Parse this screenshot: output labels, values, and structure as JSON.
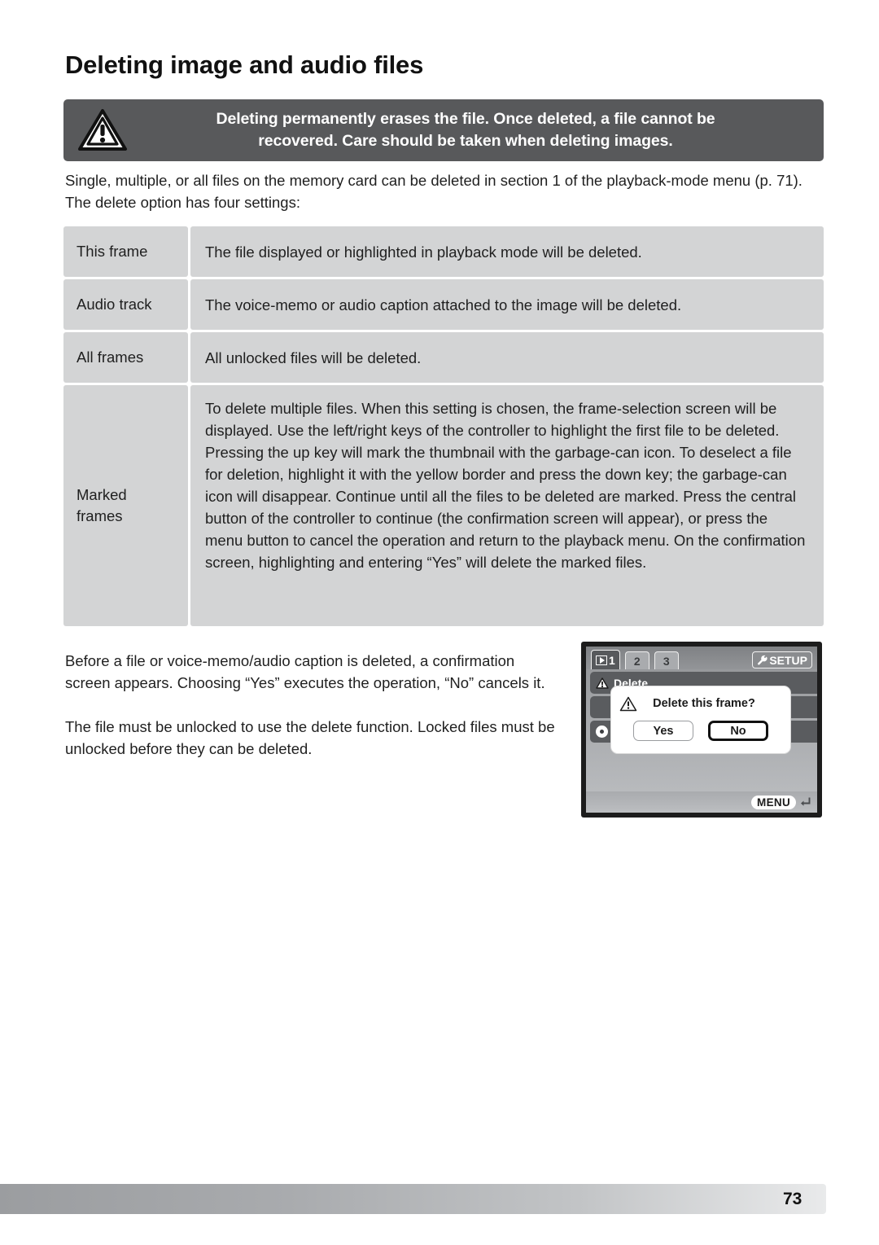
{
  "page": {
    "title": "Deleting image and audio files",
    "number": "73"
  },
  "warning": {
    "icon": "warning-triangle-icon",
    "line1": "Deleting permanently erases the file. Once deleted, a file cannot be",
    "line2": "recovered. Care should be taken when deleting images.",
    "background_color": "#58595b",
    "text_color": "#ffffff"
  },
  "intro": {
    "text": "Single, multiple, or all files on the memory card can be deleted in section 1 of the playback-mode menu (p. 71). The delete option has four settings:"
  },
  "settings_table": {
    "cell_color": "#d3d4d5",
    "rows": [
      {
        "label": "This frame",
        "description": "The file displayed or highlighted in playback mode will be deleted."
      },
      {
        "label": "Audio track",
        "description": "The voice-memo or audio caption attached to the image will be deleted."
      },
      {
        "label": "All frames",
        "description": "All unlocked files will be deleted."
      },
      {
        "label": "Marked frames",
        "description": "To delete multiple files. When this setting is chosen, the frame-selection screen will be displayed. Use the left/right keys of the controller to highlight the first file to be deleted. Pressing the up key will mark the thumbnail with the garbage-can icon. To deselect a file for deletion, highlight it with the yellow border and press the down key; the garbage-can icon will disappear. Continue until all the files to be deleted are marked. Press the central button of the controller to continue (the confirmation screen will appear), or press the menu button to cancel the operation and return to the playback menu. On the confirmation screen, highlighting and entering “Yes” will delete the marked files."
      }
    ]
  },
  "body_paragraphs": [
    "Before a file or voice-memo/audio caption is deleted, a confirmation screen appears. Choosing “Yes” executes the operation, “No” cancels it.",
    "The file must be unlocked to use the delete function. Locked files must be unlocked before they can be deleted."
  ],
  "camera_screen": {
    "tabs": [
      {
        "label": "1",
        "icon": "playback-icon",
        "active": true
      },
      {
        "label": "2",
        "icon": "",
        "active": false
      },
      {
        "label": "3",
        "icon": "",
        "active": false
      }
    ],
    "setup_button": {
      "label": "SETUP",
      "icon": "wrench-icon"
    },
    "menu_rows": [
      {
        "label": "Delete",
        "icon": "warning-triangle-icon"
      },
      {
        "label": "",
        "icon": ""
      },
      {
        "label": "",
        "icon": "lock-icon"
      }
    ],
    "dialog": {
      "icon": "warning-triangle-icon",
      "message": "Delete this frame?",
      "buttons": [
        {
          "label": "Yes",
          "selected": false
        },
        {
          "label": "No",
          "selected": true
        }
      ]
    },
    "bottom_bar": {
      "menu_label": "MENU",
      "return_icon": "return-arrow-icon"
    }
  }
}
